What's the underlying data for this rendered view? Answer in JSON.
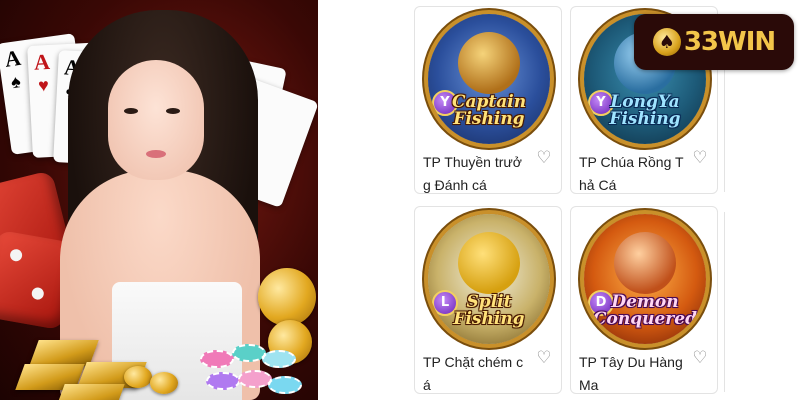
{
  "brand": {
    "logo_text": "33WIN"
  },
  "colors": {
    "brand_gold": "#f3c64a",
    "brand_bg": "#2a0a08",
    "card_border": "#e3e3e3"
  },
  "games": [
    {
      "name_line1": "TP Thuyền trưở",
      "name_line2": "g Đánh cá",
      "logo_line1": "Captain",
      "logo_line2": "Fishing",
      "provider_badge": "Y",
      "favorite_icon": "heart-outline-icon"
    },
    {
      "name_line1": "TP Chúa Rồng T",
      "name_line2": "hả Cá",
      "logo_line1": "LongYa",
      "logo_line2": "Fishing",
      "provider_badge": "Y",
      "favorite_icon": "heart-outline-icon"
    },
    {
      "name_line1": "TP Chặt chém c",
      "name_line2": "á",
      "logo_line1": "Split",
      "logo_line2": "Fishing",
      "provider_badge": "L",
      "favorite_icon": "heart-outline-icon"
    },
    {
      "name_line1": "TP Tây Du Hàng",
      "name_line2": "Ma",
      "logo_line1": "Demon",
      "logo_line2": "Conquered",
      "provider_badge": "D",
      "favorite_icon": "heart-outline-icon"
    }
  ],
  "banner": {
    "card_rank": "A"
  }
}
